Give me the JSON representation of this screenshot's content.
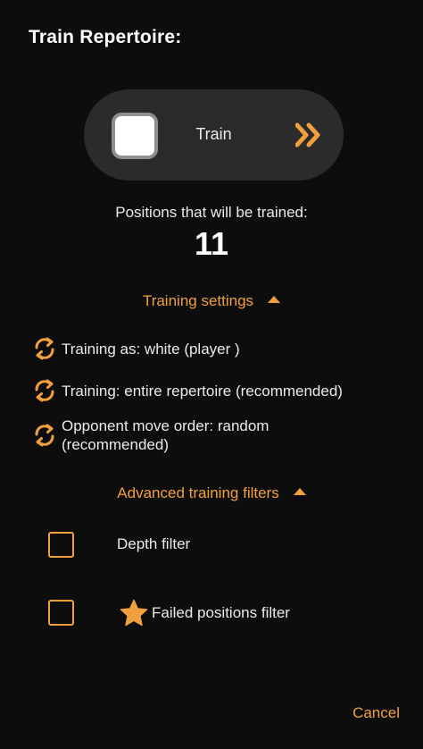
{
  "page": {
    "title": "Train Repertoire:"
  },
  "train_button": {
    "label": "Train"
  },
  "positions": {
    "label": "Positions that will be trained:",
    "count": "11"
  },
  "training_settings": {
    "header": "Training settings",
    "items": [
      {
        "text": "Training as: white (player )"
      },
      {
        "text": "Training: entire repertoire (recommended)"
      },
      {
        "text": "Opponent move order: random (recommended)"
      }
    ]
  },
  "advanced_filters": {
    "header": "Advanced training filters",
    "filters": [
      {
        "label": "Depth filter",
        "checked": false
      },
      {
        "label": "Failed positions filter",
        "checked": false
      }
    ]
  },
  "footer": {
    "cancel_label": "Cancel"
  },
  "colors": {
    "accent": "#f2a03d",
    "background": "#0d0d0d",
    "pill": "#2b2b2b"
  },
  "icons": {
    "train_arrow": "double-chevron-right-icon",
    "setting": "sync-icon",
    "failed_filter": "star-icon",
    "section_toggle": "caret-up-icon"
  }
}
